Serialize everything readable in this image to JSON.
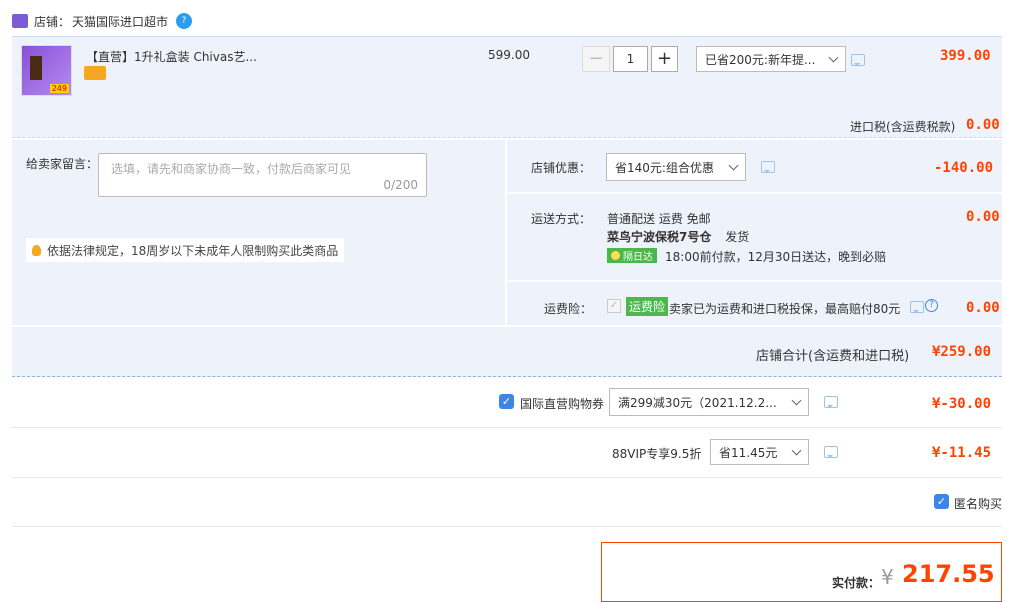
{
  "shop": {
    "label": "店铺：",
    "name": "天猫国际进口超市"
  },
  "item": {
    "title": "【直营】1升礼盒装 Chivas艺...",
    "thumb_price": "249",
    "unit_price": "599.00",
    "qty": "1",
    "promo": "已省200元:新年提...",
    "total": "399.00"
  },
  "tax": {
    "label": "进口税(含运费税款)",
    "value": "0.00"
  },
  "message": {
    "label": "给卖家留言：",
    "placeholder": "选填，请先和商家协商一致，付款后商家可见",
    "counter": "0/200"
  },
  "law_note": "依据法律规定，18周岁以下未成年人限制购买此类商品",
  "shop_discount": {
    "label": "店铺优惠：",
    "selected": "省140元:组合优惠",
    "value": "-140.00"
  },
  "shipping": {
    "label": "运送方式：",
    "line1": "普通配送 运费 免邮",
    "warehouse": "菜鸟宁波保税7号仓",
    "ship_word": "发货",
    "badge": "隔日达",
    "eta": "18:00前付款，12月30日送达，晚到必赔",
    "value": "0.00"
  },
  "insurance": {
    "label": "运费险：",
    "badge": "运费险",
    "text": "卖家已为运费和进口税投保，最高赔付80元",
    "value": "0.00"
  },
  "shop_total": {
    "label": "店铺合计(含运费和进口税)",
    "value": "¥259.00"
  },
  "coupon": {
    "label": "国际直营购物券",
    "selected": "满299减30元（2021.12.2...",
    "value": "¥-30.00"
  },
  "vip": {
    "label": "88VIP专享9.5折",
    "selected": "省11.45元",
    "value": "¥-11.45"
  },
  "anon": {
    "label": "匿名购买"
  },
  "pay": {
    "label": "实付款：",
    "currency": "¥",
    "amount": "217.55"
  },
  "colors": {
    "accent": "#f40",
    "panel": "#eef3fb",
    "check": "#3e86e6",
    "green": "#4cb84c"
  }
}
